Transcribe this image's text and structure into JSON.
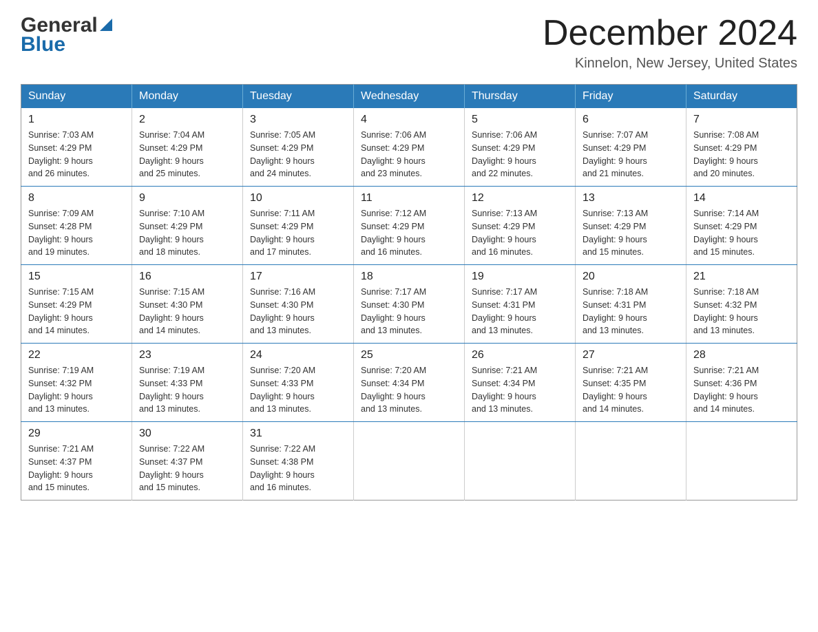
{
  "header": {
    "logo_general": "General",
    "logo_blue": "Blue",
    "month_title": "December 2024",
    "location": "Kinnelon, New Jersey, United States"
  },
  "weekdays": [
    "Sunday",
    "Monday",
    "Tuesday",
    "Wednesday",
    "Thursday",
    "Friday",
    "Saturday"
  ],
  "weeks": [
    [
      {
        "day": "1",
        "sunrise": "7:03 AM",
        "sunset": "4:29 PM",
        "daylight": "9 hours and 26 minutes."
      },
      {
        "day": "2",
        "sunrise": "7:04 AM",
        "sunset": "4:29 PM",
        "daylight": "9 hours and 25 minutes."
      },
      {
        "day": "3",
        "sunrise": "7:05 AM",
        "sunset": "4:29 PM",
        "daylight": "9 hours and 24 minutes."
      },
      {
        "day": "4",
        "sunrise": "7:06 AM",
        "sunset": "4:29 PM",
        "daylight": "9 hours and 23 minutes."
      },
      {
        "day": "5",
        "sunrise": "7:06 AM",
        "sunset": "4:29 PM",
        "daylight": "9 hours and 22 minutes."
      },
      {
        "day": "6",
        "sunrise": "7:07 AM",
        "sunset": "4:29 PM",
        "daylight": "9 hours and 21 minutes."
      },
      {
        "day": "7",
        "sunrise": "7:08 AM",
        "sunset": "4:29 PM",
        "daylight": "9 hours and 20 minutes."
      }
    ],
    [
      {
        "day": "8",
        "sunrise": "7:09 AM",
        "sunset": "4:28 PM",
        "daylight": "9 hours and 19 minutes."
      },
      {
        "day": "9",
        "sunrise": "7:10 AM",
        "sunset": "4:29 PM",
        "daylight": "9 hours and 18 minutes."
      },
      {
        "day": "10",
        "sunrise": "7:11 AM",
        "sunset": "4:29 PM",
        "daylight": "9 hours and 17 minutes."
      },
      {
        "day": "11",
        "sunrise": "7:12 AM",
        "sunset": "4:29 PM",
        "daylight": "9 hours and 16 minutes."
      },
      {
        "day": "12",
        "sunrise": "7:13 AM",
        "sunset": "4:29 PM",
        "daylight": "9 hours and 16 minutes."
      },
      {
        "day": "13",
        "sunrise": "7:13 AM",
        "sunset": "4:29 PM",
        "daylight": "9 hours and 15 minutes."
      },
      {
        "day": "14",
        "sunrise": "7:14 AM",
        "sunset": "4:29 PM",
        "daylight": "9 hours and 15 minutes."
      }
    ],
    [
      {
        "day": "15",
        "sunrise": "7:15 AM",
        "sunset": "4:29 PM",
        "daylight": "9 hours and 14 minutes."
      },
      {
        "day": "16",
        "sunrise": "7:15 AM",
        "sunset": "4:30 PM",
        "daylight": "9 hours and 14 minutes."
      },
      {
        "day": "17",
        "sunrise": "7:16 AM",
        "sunset": "4:30 PM",
        "daylight": "9 hours and 13 minutes."
      },
      {
        "day": "18",
        "sunrise": "7:17 AM",
        "sunset": "4:30 PM",
        "daylight": "9 hours and 13 minutes."
      },
      {
        "day": "19",
        "sunrise": "7:17 AM",
        "sunset": "4:31 PM",
        "daylight": "9 hours and 13 minutes."
      },
      {
        "day": "20",
        "sunrise": "7:18 AM",
        "sunset": "4:31 PM",
        "daylight": "9 hours and 13 minutes."
      },
      {
        "day": "21",
        "sunrise": "7:18 AM",
        "sunset": "4:32 PM",
        "daylight": "9 hours and 13 minutes."
      }
    ],
    [
      {
        "day": "22",
        "sunrise": "7:19 AM",
        "sunset": "4:32 PM",
        "daylight": "9 hours and 13 minutes."
      },
      {
        "day": "23",
        "sunrise": "7:19 AM",
        "sunset": "4:33 PM",
        "daylight": "9 hours and 13 minutes."
      },
      {
        "day": "24",
        "sunrise": "7:20 AM",
        "sunset": "4:33 PM",
        "daylight": "9 hours and 13 minutes."
      },
      {
        "day": "25",
        "sunrise": "7:20 AM",
        "sunset": "4:34 PM",
        "daylight": "9 hours and 13 minutes."
      },
      {
        "day": "26",
        "sunrise": "7:21 AM",
        "sunset": "4:34 PM",
        "daylight": "9 hours and 13 minutes."
      },
      {
        "day": "27",
        "sunrise": "7:21 AM",
        "sunset": "4:35 PM",
        "daylight": "9 hours and 14 minutes."
      },
      {
        "day": "28",
        "sunrise": "7:21 AM",
        "sunset": "4:36 PM",
        "daylight": "9 hours and 14 minutes."
      }
    ],
    [
      {
        "day": "29",
        "sunrise": "7:21 AM",
        "sunset": "4:37 PM",
        "daylight": "9 hours and 15 minutes."
      },
      {
        "day": "30",
        "sunrise": "7:22 AM",
        "sunset": "4:37 PM",
        "daylight": "9 hours and 15 minutes."
      },
      {
        "day": "31",
        "sunrise": "7:22 AM",
        "sunset": "4:38 PM",
        "daylight": "9 hours and 16 minutes."
      },
      null,
      null,
      null,
      null
    ]
  ],
  "labels": {
    "sunrise": "Sunrise:",
    "sunset": "Sunset:",
    "daylight": "Daylight:"
  }
}
